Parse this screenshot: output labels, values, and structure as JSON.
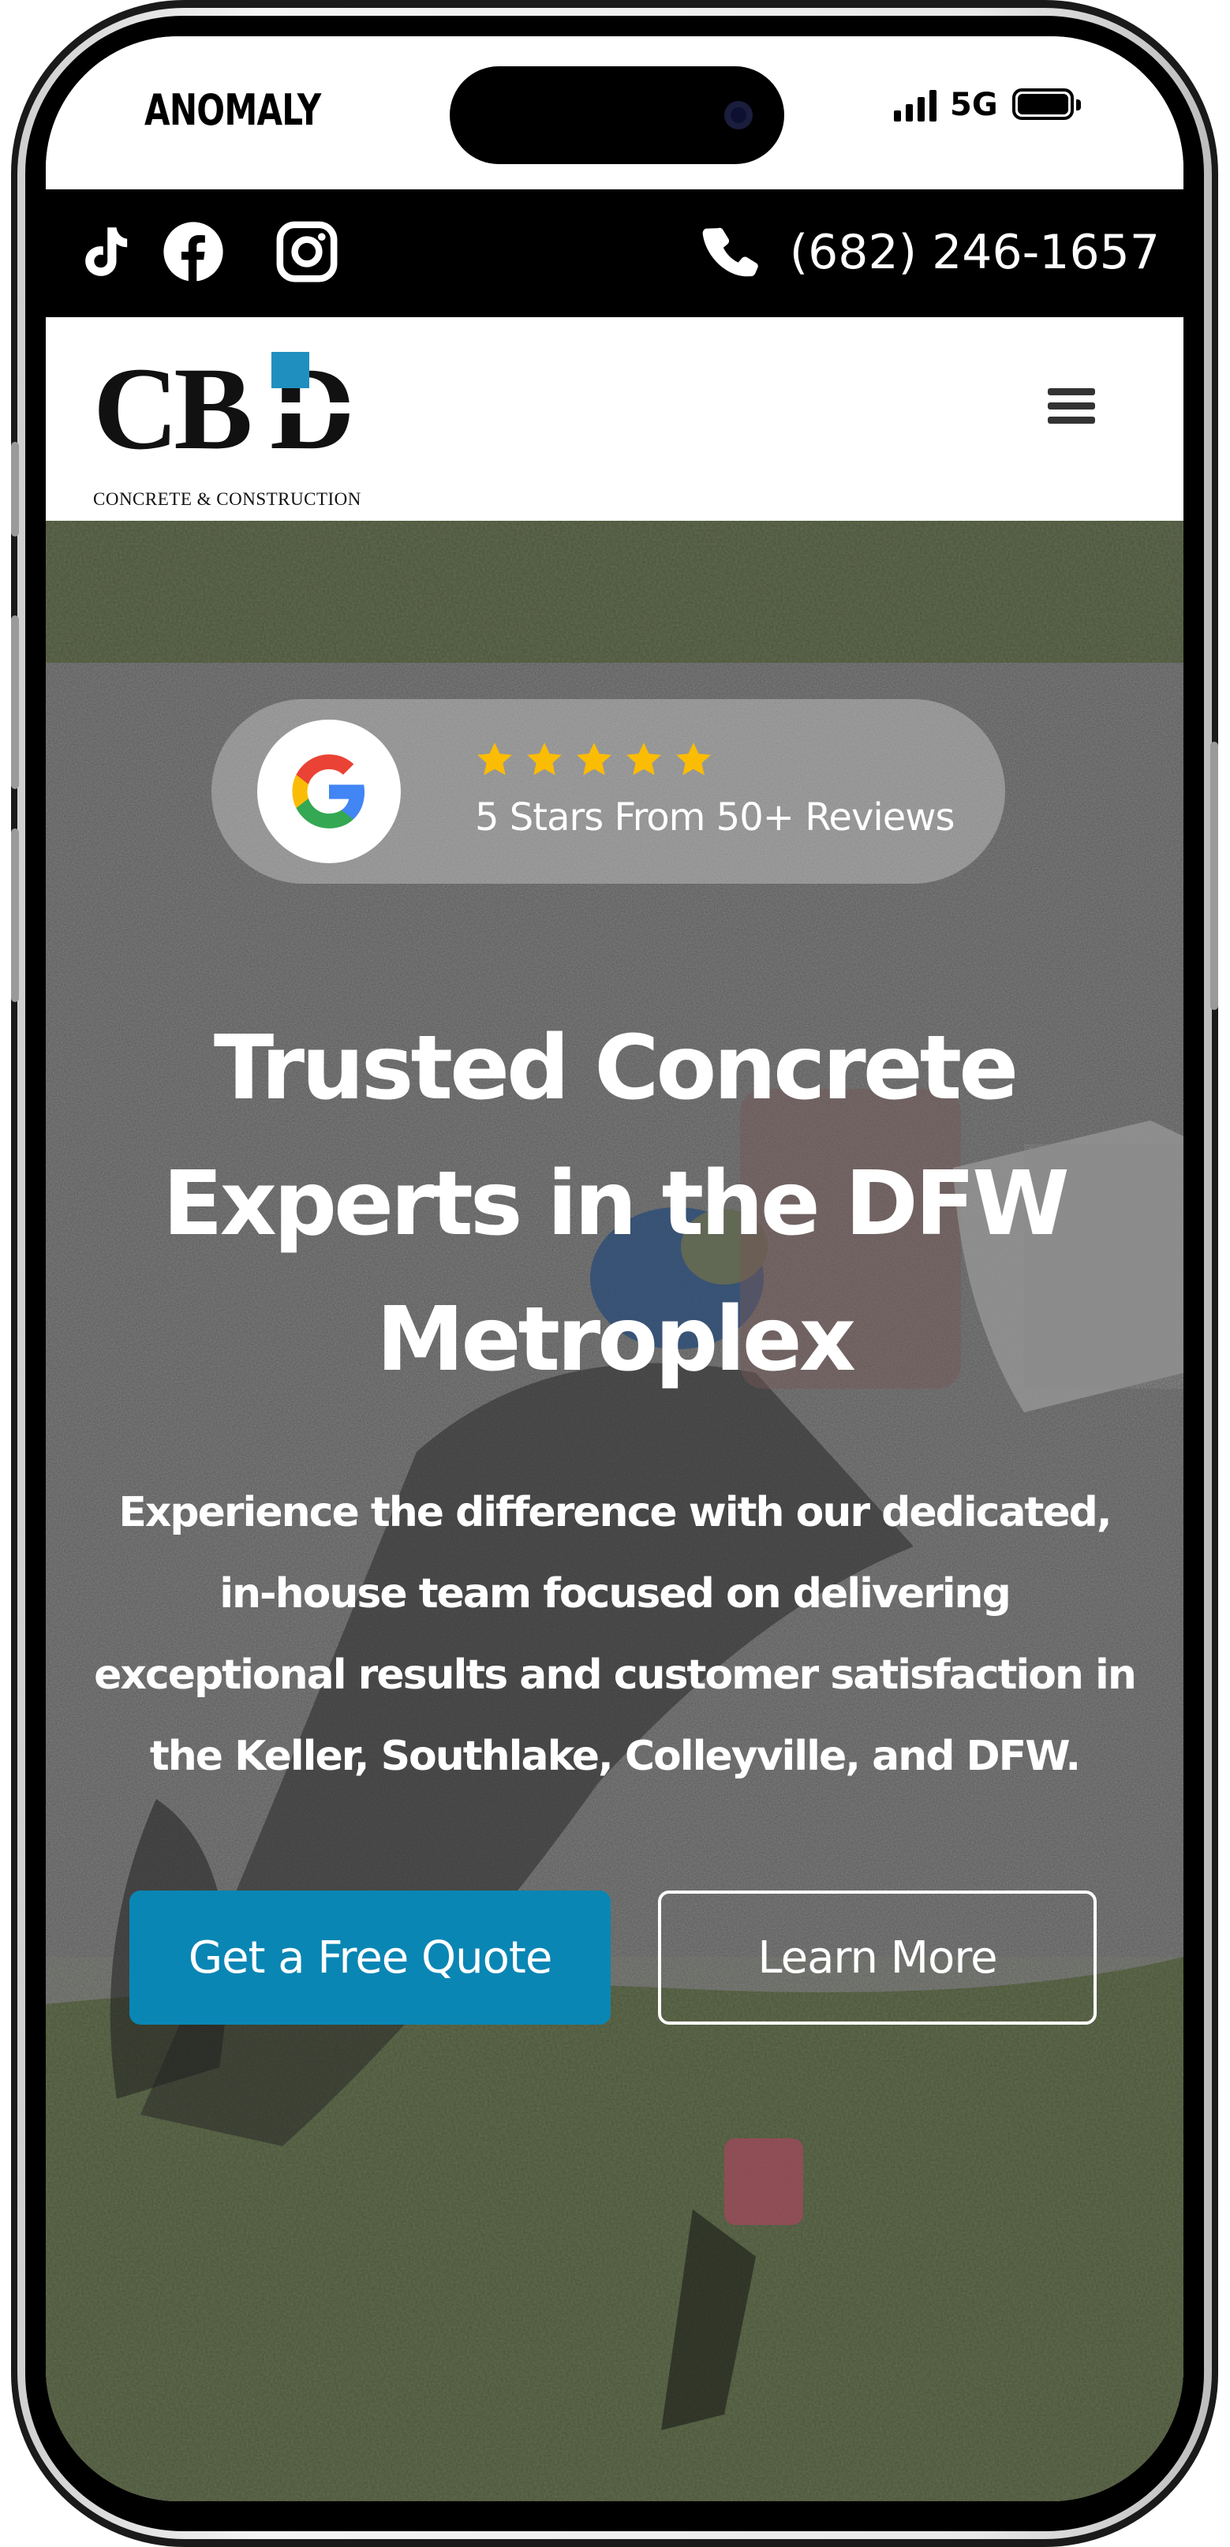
{
  "status_bar": {
    "carrier": "ANOMALY",
    "network": "5G"
  },
  "top_bar": {
    "social_icons": [
      "tiktok-icon",
      "facebook-icon",
      "instagram-icon"
    ],
    "phone_number": "(682) 246-1657",
    "phone_icon": "phone-icon"
  },
  "header": {
    "logo_text": "CBD",
    "logo_subtitle": "CONCRETE & CONSTRUCTION",
    "menu_icon": "hamburger-menu-icon",
    "colors": {
      "logo_black": "#111111",
      "logo_blue": "#1f8fc0"
    }
  },
  "hero": {
    "review_badge": {
      "icon": "google-icon",
      "stars": 5,
      "text": "5 Stars From 50+ Reviews",
      "star_color": "#fbbc04"
    },
    "title_lines": [
      "Trusted Concrete",
      "Experts in the DFW",
      "Metroplex"
    ],
    "subtitle_lines": [
      "Experience the difference with our dedicated,",
      "in-house team focused on delivering",
      "exceptional results and customer satisfaction in",
      "the Keller, Southlake, Colleyville, and DFW."
    ],
    "primary_button": "Get a Free Quote",
    "secondary_button": "Learn More",
    "colors": {
      "primary_button_bg": "#0a86b4",
      "text": "#ffffff"
    }
  }
}
